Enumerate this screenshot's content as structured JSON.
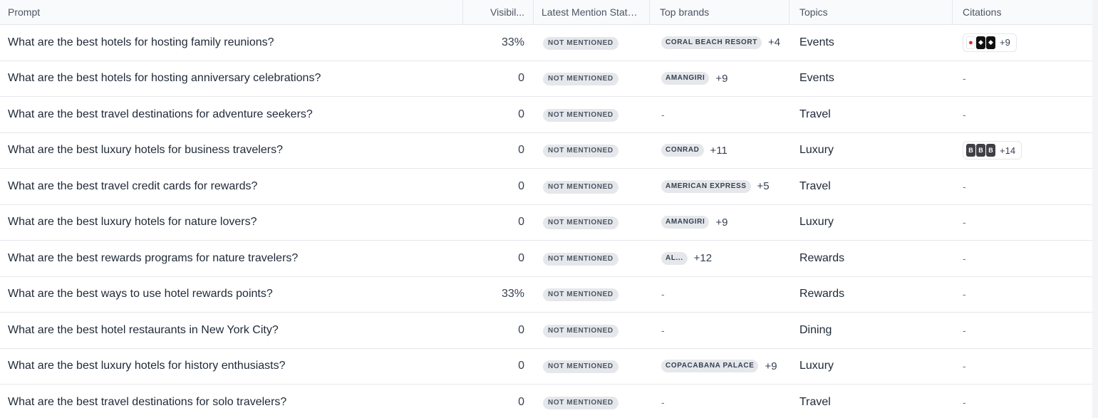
{
  "columns": {
    "prompt": "Prompt",
    "visibility": "Visibil...",
    "status": "Latest Mention Statu...",
    "brands": "Top brands",
    "topics": "Topics",
    "citations": "Citations"
  },
  "rows": [
    {
      "prompt": "What are the best hotels for hosting family reunions?",
      "visibility": "33%",
      "status": "NOT MENTIONED",
      "brand": "CORAL BEACH RESORT",
      "brand_more": "+4",
      "topic": "Events",
      "citations": {
        "icons": [
          "red-logo-icon",
          "black-logo-icon",
          "black-logo-icon"
        ],
        "letters": [
          "",
          "",
          ""
        ],
        "more": "+9"
      }
    },
    {
      "prompt": "What are the best hotels for hosting anniversary celebrations?",
      "visibility": "0",
      "status": "NOT MENTIONED",
      "brand": "AMANGIRI",
      "brand_more": "+9",
      "topic": "Events",
      "citations": null
    },
    {
      "prompt": "What are the best travel destinations for adventure seekers?",
      "visibility": "0",
      "status": "NOT MENTIONED",
      "brand": null,
      "brand_more": null,
      "topic": "Travel",
      "citations": null
    },
    {
      "prompt": "What are the best luxury hotels for business travelers?",
      "visibility": "0",
      "status": "NOT MENTIONED",
      "brand": "CONRAD",
      "brand_more": "+11",
      "topic": "Luxury",
      "citations": {
        "icons": [
          "gray-logo-icon",
          "gray-logo-icon",
          "gray-logo-icon"
        ],
        "letters": [
          "B",
          "B",
          "B"
        ],
        "more": "+14"
      }
    },
    {
      "prompt": "What are the best travel credit cards for rewards?",
      "visibility": "0",
      "status": "NOT MENTIONED",
      "brand": "AMERICAN EXPRESS",
      "brand_more": "+5",
      "topic": "Travel",
      "citations": null
    },
    {
      "prompt": "What are the best luxury hotels for nature lovers?",
      "visibility": "0",
      "status": "NOT MENTIONED",
      "brand": "AMANGIRI",
      "brand_more": "+9",
      "topic": "Luxury",
      "citations": null
    },
    {
      "prompt": "What are the best rewards programs for nature travelers?",
      "visibility": "0",
      "status": "NOT MENTIONED",
      "brand": "AL...",
      "brand_more": "+12",
      "topic": "Rewards",
      "citations": null
    },
    {
      "prompt": "What are the best ways to use hotel rewards points?",
      "visibility": "33%",
      "status": "NOT MENTIONED",
      "brand": null,
      "brand_more": null,
      "topic": "Rewards",
      "citations": null
    },
    {
      "prompt": "What are the best hotel restaurants in New York City?",
      "visibility": "0",
      "status": "NOT MENTIONED",
      "brand": null,
      "brand_more": null,
      "topic": "Dining",
      "citations": null
    },
    {
      "prompt": "What are the best luxury hotels for history enthusiasts?",
      "visibility": "0",
      "status": "NOT MENTIONED",
      "brand": "COPACABANA PALACE",
      "brand_more": "+9",
      "topic": "Luxury",
      "citations": null
    },
    {
      "prompt": "What are the best travel destinations for solo travelers?",
      "visibility": "0",
      "status": "NOT MENTIONED",
      "brand": null,
      "brand_more": null,
      "topic": "Travel",
      "citations": null
    }
  ],
  "empty_placeholder": "-"
}
